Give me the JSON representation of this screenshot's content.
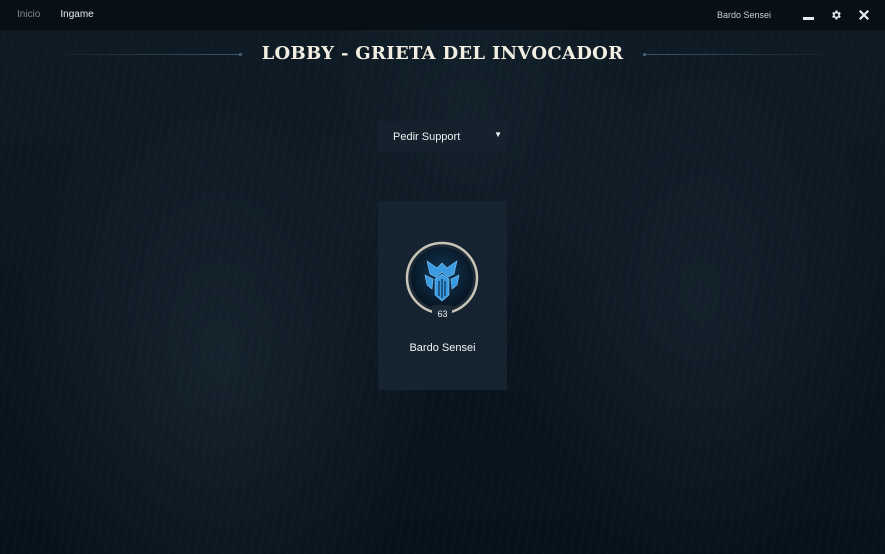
{
  "nav": {
    "items": [
      {
        "label": "Inicio",
        "active": false
      },
      {
        "label": "Ingame",
        "active": true
      }
    ]
  },
  "topbar": {
    "username": "Bardo Sensei",
    "icons": [
      "minimize-icon",
      "gear-icon",
      "close-icon"
    ]
  },
  "page": {
    "title": "LOBBY - GRIETA DEL INVOCADOR"
  },
  "role_select": {
    "selected": "Pedir Support"
  },
  "summoner": {
    "name": "Bardo Sensei",
    "level": "63",
    "icon": "summoner-profile-icon"
  },
  "colors": {
    "background": "#0b1620",
    "title": "#f3eee2",
    "panel": "#15222d",
    "icon_blue": "#3a9be0"
  }
}
